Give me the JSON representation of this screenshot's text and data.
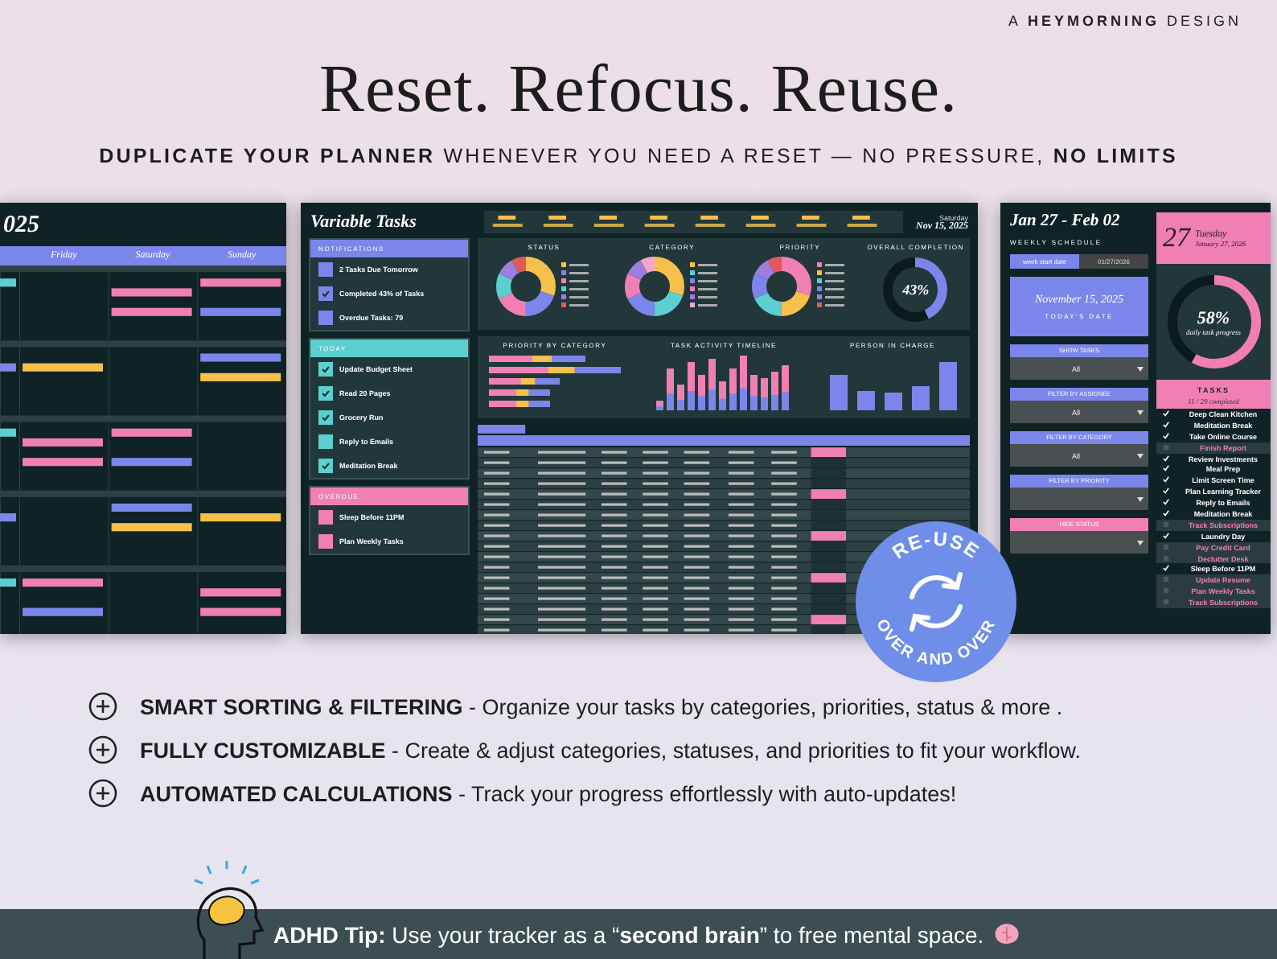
{
  "brand": "A **HEYMORNING** DESIGN",
  "headline": "Reset. Refocus. Reuse.",
  "subheadline": "**DUPLICATE YOUR PLANNER** WHENEVER YOU NEED A RESET — NO PRESSURE, **NO LIMITS**",
  "calendar": {
    "title": "025",
    "days": [
      "Friday",
      "Saturday",
      "Sunday"
    ]
  },
  "dashboard": {
    "title": "Variable Tasks",
    "weekday": "Saturday",
    "date": "Nov 15, 2025",
    "sidebar_sections": [
      {
        "title": "NOTIFICATIONS",
        "kind": "blue",
        "items": [
          {
            "title": "2 Tasks Due Tomorrow",
            "done": false
          },
          {
            "title": "Completed 43% of Tasks",
            "done": true
          },
          {
            "title": "Overdue Tasks: 79",
            "done": false
          }
        ]
      },
      {
        "title": "TODAY",
        "kind": "teal",
        "items": [
          {
            "title": "Update Budget Sheet",
            "done": true
          },
          {
            "title": "Read 20 Pages",
            "done": true
          },
          {
            "title": "Grocery Run",
            "done": true
          },
          {
            "title": "Reply to Emails",
            "done": false
          },
          {
            "title": "Meditation Break",
            "done": true
          }
        ]
      },
      {
        "title": "OVERDUE",
        "kind": "pink",
        "items": [
          {
            "title": "Sleep Before 11PM",
            "done": false
          },
          {
            "title": "Plan Weekly Tasks",
            "done": false
          }
        ]
      }
    ],
    "charts": [
      "STATUS",
      "CATEGORY",
      "PRIORITY"
    ],
    "completion": {
      "title": "OVERALL COMPLETION",
      "reading": "43%",
      "level": 0.43
    },
    "lower_charts": [
      "PRIORITY BY CATEGORY",
      "TASK ACTIVITY TIMELINE",
      "PERSON IN CHARGE"
    ]
  },
  "weekly": {
    "title": "Jan 27 - Feb 02",
    "subtitle": "WEEKLY SCHEDULE",
    "start_label": "week start date",
    "start_value": "01/27/2026",
    "today": "November 15, 2025",
    "today_label": "TODAY'S DATE",
    "filters": [
      {
        "label": "SHOW TASKS",
        "value": "All",
        "kind": "blue"
      },
      {
        "label": "FILTER BY ASSIGNEE",
        "value": "All",
        "kind": "blue"
      },
      {
        "label": "FILTER BY CATEGORY",
        "value": "All",
        "kind": "blue"
      },
      {
        "label": "FILTER BY PRIORITY",
        "kind": "blue"
      },
      {
        "label": "HIDE STATUS",
        "kind": "pink"
      }
    ],
    "day_number": "27",
    "day_name": "Tuesday",
    "day_date": "January 27, 2026",
    "progress": {
      "reading": "58%",
      "label": "daily task progress",
      "level": 0.58
    },
    "tasks_title": "TASKS",
    "tasks_count": "11 / 29 completed",
    "tasks": [
      {
        "name": "Deep Clean Kitchen",
        "checked": true
      },
      {
        "name": "Meditation Break",
        "checked": true
      },
      {
        "name": "Take Online Course",
        "checked": true
      },
      {
        "name": "Finish Report",
        "checked": false
      },
      {
        "name": "Review Investments",
        "checked": true
      },
      {
        "name": "Meal Prep",
        "checked": true
      },
      {
        "name": "Limit Screen Time",
        "checked": true
      },
      {
        "name": "Plan Learning Tracker",
        "checked": true
      },
      {
        "name": "Reply to Emails",
        "checked": true
      },
      {
        "name": "Meditation Break",
        "checked": true
      },
      {
        "name": "Track Subscriptions",
        "checked": false
      },
      {
        "name": "Laundry Day",
        "checked": true
      },
      {
        "name": "Pay Credit Card",
        "checked": false
      },
      {
        "name": "Declutter Desk",
        "checked": false
      },
      {
        "name": "Sleep Before 11PM",
        "checked": true
      },
      {
        "name": "Update Resume",
        "checked": false
      },
      {
        "name": "Plan Weekly Tasks",
        "checked": false
      },
      {
        "name": "Track Subscriptions",
        "checked": false
      }
    ]
  },
  "badge": {
    "top": "RE-USE",
    "bottom": "OVER AND OVER"
  },
  "features": [
    "**SMART SORTING & FILTERING** - Organize your tasks by categories, priorities, status & more .",
    "**FULLY CUSTOMIZABLE** - Create & adjust categories, statuses, and priorities to fit your workflow.",
    "**AUTOMATED CALCULATIONS** - Track your progress effortlessly with auto-updates!"
  ],
  "tip": "**ADHD Tip:** Use your tracker as a “**second brain**” to free mental space."
}
